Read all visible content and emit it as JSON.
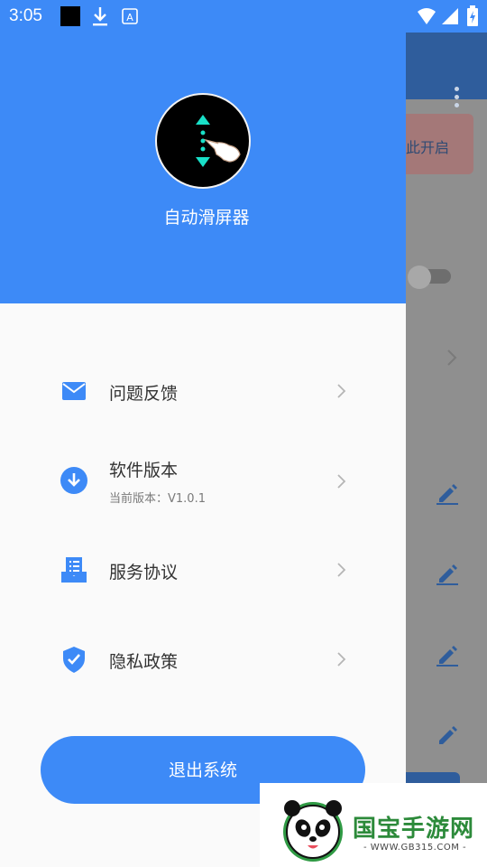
{
  "status_bar": {
    "time": "3:05",
    "icons": [
      "black-square-icon",
      "download-icon",
      "text-a-icon",
      "wifi-icon",
      "signal-icon",
      "battery-icon"
    ]
  },
  "background_app": {
    "card_text": "此开启",
    "icons": [
      "more-vert-icon",
      "toggle-switch",
      "chevron-right-icon",
      "pencil-icon"
    ]
  },
  "drawer": {
    "app_name": "自动滑屏器",
    "logo_icon": "swipe-gesture-icon",
    "menu": [
      {
        "label": "问题反馈",
        "icon": "mail-icon"
      },
      {
        "label": "软件版本",
        "sublabel": "当前版本：V1.0.1",
        "icon": "download-circle-icon"
      },
      {
        "label": "服务协议",
        "icon": "agreement-icon"
      },
      {
        "label": "隐私政策",
        "icon": "shield-check-icon"
      }
    ],
    "logout_label": "退出系统"
  },
  "watermark": {
    "title": "国宝手游网",
    "url": "- WWW.GB315.COM -"
  },
  "colors": {
    "primary": "#3d8af7",
    "scrim": "#8f8f8f",
    "text": "#333333",
    "subtext": "#7a7a7a"
  }
}
